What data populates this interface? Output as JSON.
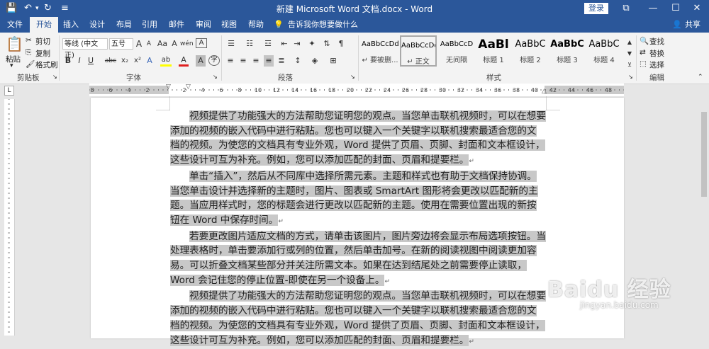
{
  "window": {
    "title": "新建 Microsoft Word 文档.docx - Word",
    "login": "登录",
    "controls": {
      "ribbon_opts": "⧉",
      "minimize": "—",
      "maximize": "☐",
      "close": "✕"
    }
  },
  "quick_access": {
    "save": "💾",
    "undo": "↶",
    "redo": "↻",
    "customize": "≡"
  },
  "tabs": [
    "文件",
    "开始",
    "插入",
    "设计",
    "布局",
    "引用",
    "邮件",
    "审阅",
    "视图",
    "帮助"
  ],
  "tell_me": "告诉我你想要做什么",
  "share": "共享",
  "ribbon": {
    "clipboard": {
      "label": "剪贴板",
      "paste": "粘贴",
      "cut": "剪切",
      "copy": "复制",
      "format_painter": "格式刷"
    },
    "font": {
      "label": "字体",
      "font_name": "等线 (中文正)",
      "font_size": "五号",
      "grow": "A",
      "shrink": "A",
      "case": "Aa",
      "clear": "A",
      "wen": "wén",
      "border_a": "A",
      "bold": "B",
      "italic": "I",
      "underline": "U",
      "strike": "abc",
      "sub": "x₂",
      "sup": "x²",
      "effects": "A",
      "highlight": "ab",
      "color": "A",
      "shading": "A",
      "circle": "字"
    },
    "paragraph": {
      "label": "段落"
    },
    "styles": {
      "label": "样式",
      "items": [
        {
          "preview": "AaBbCcDd",
          "name": "↵ 要被删..."
        },
        {
          "preview": "AaBbCcDd",
          "name": "↵ 正文"
        },
        {
          "preview": "AaBbCcD",
          "name": "无间隔"
        },
        {
          "preview": "AaBl",
          "name": "标题 1"
        },
        {
          "preview": "AaBbC",
          "name": "标题 2"
        },
        {
          "preview": "AaBbC",
          "name": "标题 3"
        },
        {
          "preview": "AaBbC",
          "name": "标题 4"
        }
      ]
    },
    "editing": {
      "label": "编辑",
      "find": "查找",
      "replace": "替换",
      "select": "选择"
    }
  },
  "document": {
    "paragraphs": [
      "视频提供了功能强大的方法帮助您证明您的观点。当您单击联机视频时，可以在想要添加的视频的嵌入代码中进行粘贴。您也可以键入一个关键字以联机搜索最适合您的文档的视频。为使您的文档具有专业外观，Word 提供了页眉、页脚、封面和文本框设计，这些设计可互为补充。例如，您可以添加匹配的封面、页眉和提要栏。",
      "单击“插入”，然后从不同库中选择所需元素。主题和样式也有助于文档保持协调。当您单击设计并选择新的主题时，图片、图表或 SmartArt 图形将会更改以匹配新的主题。当应用样式时，您的标题会进行更改以匹配新的主题。使用在需要位置出现的新按钮在 Word 中保存时间。",
      "若要更改图片适应文档的方式，请单击该图片，图片旁边将会显示布局选项按钮。当处理表格时，单击要添加行或列的位置，然后单击加号。在新的阅读视图中阅读更加容易。可以折叠文档某些部分并关注所需文本。如果在达到结尾处之前需要停止读取，Word 会记住您的停止位置-即使在另一个设备上。",
      "视频提供了功能强大的方法帮助您证明您的观点。当您单击联机视频时，可以在想要添加的视频的嵌入代码中进行粘贴。您也可以键入一个关键字以联机搜索最适合您的文档的视频。为使您的文档具有专业外观，Word 提供了页眉、页脚、封面和文本框设计，这些设计可互为补充。例如，您可以添加匹配的封面、页眉和提要栏。"
    ],
    "para_mark": "↵"
  },
  "watermark": {
    "text": "Baidu 经验",
    "sub": "jingyan.baidu.com"
  },
  "ruler": {
    "top_numbers": [
      "8",
      "6",
      "4",
      "2",
      "",
      "2",
      "4",
      "6",
      "8",
      "10",
      "12",
      "14",
      "16",
      "18",
      "20",
      "22",
      "24",
      "26",
      "28",
      "30",
      "32",
      "34",
      "36",
      "38",
      "40",
      "42",
      "44",
      "46",
      "48"
    ]
  },
  "colors": {
    "accent": "#2b579a",
    "selection": "#c8c8c8",
    "ribbon_bg": "#f3f3f3",
    "workspace": "#e6e6e6"
  }
}
